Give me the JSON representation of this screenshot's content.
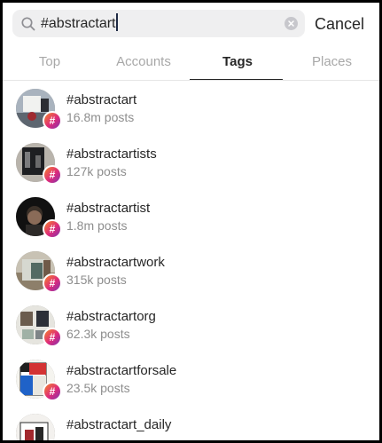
{
  "search": {
    "query": "#abstractart",
    "cancel_label": "Cancel"
  },
  "tabs": [
    {
      "label": "Top",
      "active": false
    },
    {
      "label": "Accounts",
      "active": false
    },
    {
      "label": "Tags",
      "active": true
    },
    {
      "label": "Places",
      "active": false
    }
  ],
  "results": [
    {
      "tag": "#abstractart",
      "posts": "16.8m posts"
    },
    {
      "tag": "#abstractartists",
      "posts": "127k posts"
    },
    {
      "tag": "#abstractartist",
      "posts": "1.8m posts"
    },
    {
      "tag": "#abstractartwork",
      "posts": "315k posts"
    },
    {
      "tag": "#abstractartorg",
      "posts": "62.3k posts"
    },
    {
      "tag": "#abstractartforsale",
      "posts": "23.5k posts"
    },
    {
      "tag": "#abstractart_daily",
      "posts": ""
    }
  ],
  "icons": {
    "search": "search-icon",
    "clear": "clear-icon",
    "hashtag_badge": "#"
  },
  "colors": {
    "active_text": "#262626",
    "inactive_tab": "#a8a8a8",
    "secondary_text": "#8e8e8e",
    "search_background": "#efeff0",
    "badge_gradient_start": "#f58529",
    "badge_gradient_mid": "#dd2a7b",
    "badge_gradient_end": "#8134af"
  }
}
